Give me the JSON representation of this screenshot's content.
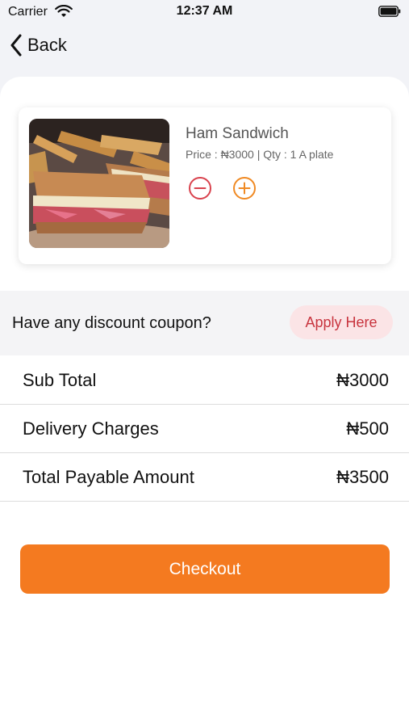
{
  "status_bar": {
    "carrier": "Carrier",
    "time": "12:37 AM"
  },
  "nav": {
    "back_label": "Back"
  },
  "cart_item": {
    "name": "Ham Sandwich",
    "meta": "Price : ₦3000 | Qty : 1 A plate",
    "image": "ham-sandwich-photo"
  },
  "coupon": {
    "prompt": "Have any discount coupon?",
    "apply_label": "Apply Here"
  },
  "summary": [
    {
      "label": "Sub Total",
      "value": "₦3000"
    },
    {
      "label": "Delivery Charges",
      "value": "₦500"
    },
    {
      "label": "Total Payable Amount",
      "value": "₦3500"
    }
  ],
  "checkout": {
    "label": "Checkout"
  },
  "colors": {
    "accent": "#f47a20",
    "minus": "#d9434e",
    "plus": "#f08a24",
    "coupon_bg": "#fbe4e6",
    "coupon_text": "#c8343e"
  }
}
